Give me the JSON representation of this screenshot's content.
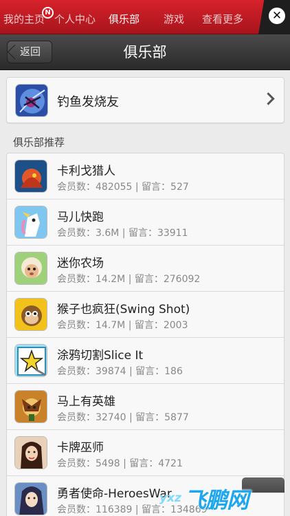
{
  "topbar": {
    "tabs": [
      {
        "label": "我的主页",
        "active": false
      },
      {
        "label": "个人中心",
        "active": false
      },
      {
        "label": "俱乐部",
        "active": true
      },
      {
        "label": "游戏",
        "active": false
      },
      {
        "label": "查看更多",
        "active": false
      }
    ],
    "notification_badge": "N",
    "close_icon": "close-icon"
  },
  "navbar": {
    "back_label": "返回",
    "title": "俱乐部"
  },
  "featured": {
    "name": "钓鱼发烧友",
    "icon": "fishing-app-icon"
  },
  "section": {
    "title": "俱乐部推荐"
  },
  "clubs": [
    {
      "name": "卡利戈猎人",
      "stats": "会员数：482055 | 留言：527",
      "icon": "dragon-game-icon"
    },
    {
      "name": "马儿快跑",
      "stats": "会员数：3.6M | 留言：33911",
      "icon": "unicorn-game-icon"
    },
    {
      "name": "迷你农场",
      "stats": "会员数：14.2M | 留言：276092",
      "icon": "sheep-game-icon"
    },
    {
      "name": "猴子也疯狂(Swing Shot)",
      "stats": "会员数：14.7M | 留言：2003",
      "icon": "monkey-game-icon"
    },
    {
      "name": "涂鸦切割Slice It",
      "stats": "会员数：39874 | 留言：186",
      "icon": "star-game-icon"
    },
    {
      "name": "马上有英雄",
      "stats": "会员数：32740 | 留言：5877",
      "icon": "warrior-game-icon"
    },
    {
      "name": "卡牌巫师",
      "stats": "会员数：5498 | 留言：4721",
      "icon": "wizard-girl-game-icon"
    },
    {
      "name": "勇者使命-HeroesWar",
      "stats": "会员数：116389 | 留言：134869",
      "icon": "heroine-game-icon"
    }
  ],
  "watermark": {
    "small": "yxz",
    "big": "飞鹏网"
  }
}
